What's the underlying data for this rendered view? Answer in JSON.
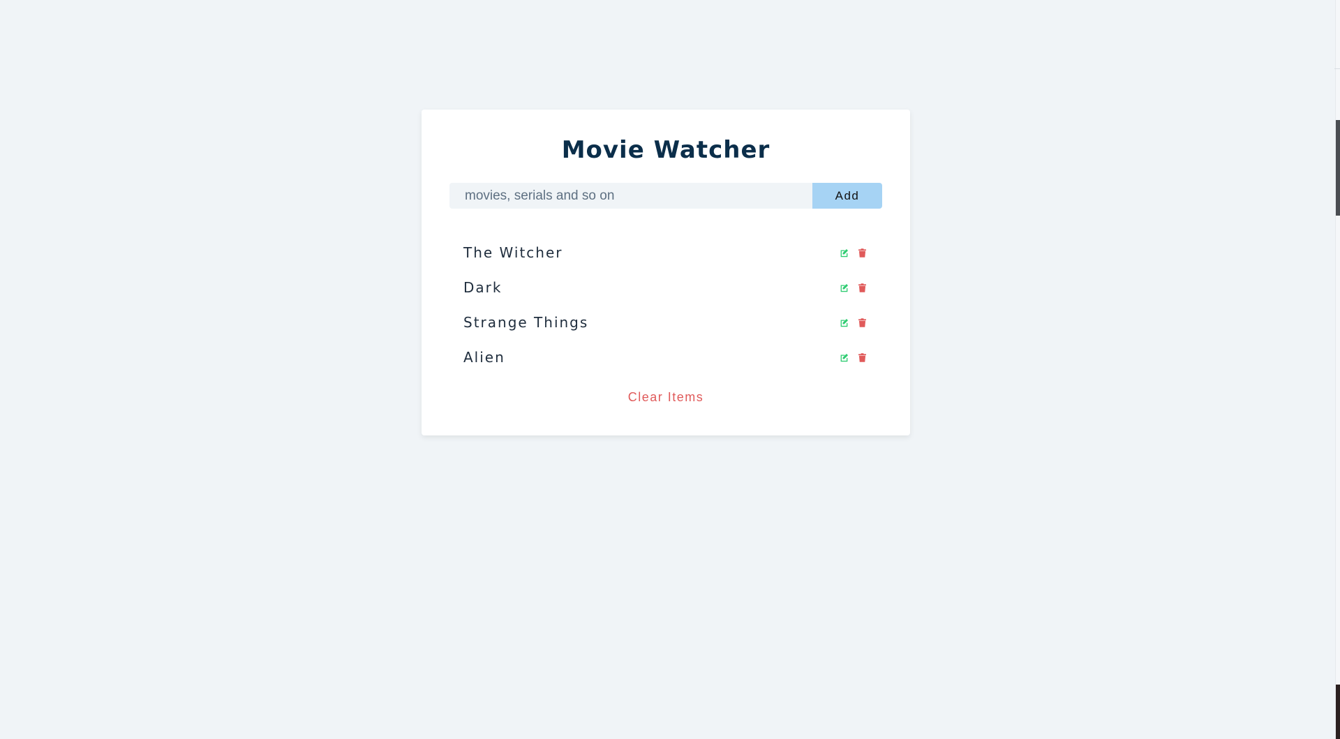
{
  "app": {
    "title": "Movie Watcher"
  },
  "form": {
    "input_value": "",
    "input_placeholder": "movies, serials and so on",
    "add_label": "Add"
  },
  "items": [
    {
      "label": "The Witcher"
    },
    {
      "label": "Dark"
    },
    {
      "label": "Strange Things"
    },
    {
      "label": "Alien"
    }
  ],
  "icons": {
    "edit": "edit-icon",
    "delete": "trash-icon"
  },
  "clear_label": "Clear Items",
  "colors": {
    "title": "#0b2e4a",
    "accent_button": "#a6d3f4",
    "edit_icon": "#2ecc71",
    "delete_icon": "#e05a5a",
    "clear_text": "#e05a5a",
    "background": "#f0f4f7"
  }
}
